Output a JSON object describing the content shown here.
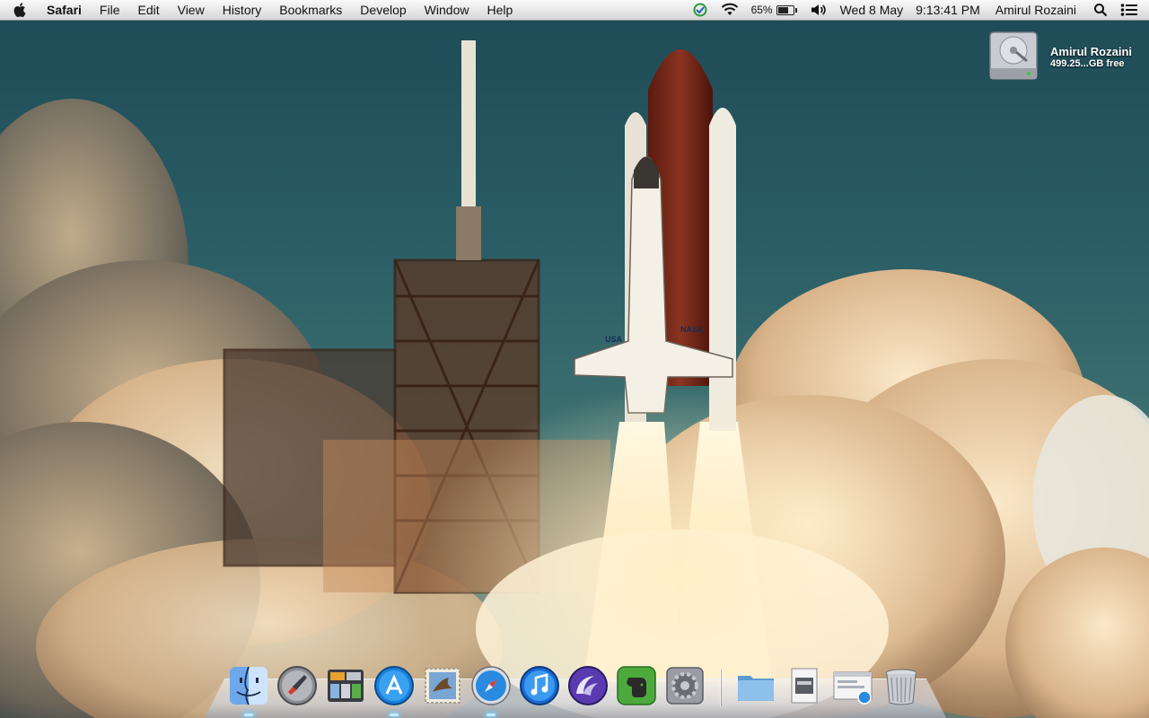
{
  "menubar": {
    "apple_icon": "apple-logo-icon",
    "app_name": "Safari",
    "menus": [
      "File",
      "Edit",
      "View",
      "History",
      "Bookmarks",
      "Develop",
      "Window",
      "Help"
    ],
    "status": {
      "sync_icon": "time-machine-sync-icon",
      "wifi_icon": "wifi-icon",
      "battery_percent": "65%",
      "battery_level": 0.65,
      "volume_icon": "speaker-volume-icon",
      "date": "Wed 8 May",
      "time": "9:13:41 PM",
      "user": "Amirul Rozaini",
      "spotlight_icon": "search-icon",
      "notifications_icon": "notification-list-icon"
    }
  },
  "desktop": {
    "wallpaper": "space-shuttle-launch",
    "drive": {
      "icon": "hard-drive-icon",
      "name": "Amirul Rozaini",
      "free": "499.25...GB free"
    }
  },
  "dock": {
    "apps": [
      {
        "name": "Finder",
        "icon": "finder-icon",
        "running": true
      },
      {
        "name": "Launchpad",
        "icon": "launchpad-rocket-icon",
        "running": false
      },
      {
        "name": "Mission Control",
        "icon": "mission-control-icon",
        "running": false
      },
      {
        "name": "App Store",
        "icon": "app-store-icon",
        "running": true
      },
      {
        "name": "Mail",
        "icon": "mail-stamp-icon",
        "running": false
      },
      {
        "name": "Safari",
        "icon": "safari-compass-icon",
        "running": true
      },
      {
        "name": "iTunes",
        "icon": "itunes-note-icon",
        "running": false
      },
      {
        "name": "BitTorrent",
        "icon": "bittorrent-icon",
        "running": false
      },
      {
        "name": "Evernote",
        "icon": "evernote-elephant-icon",
        "running": false
      },
      {
        "name": "System Preferences",
        "icon": "system-preferences-gear-icon",
        "running": false
      }
    ],
    "stacks": [
      {
        "name": "Folder",
        "icon": "folder-stack-icon"
      },
      {
        "name": "Downloads",
        "icon": "downloads-stack-icon"
      },
      {
        "name": "Web Document",
        "icon": "web-document-stack-icon"
      },
      {
        "name": "Trash",
        "icon": "trash-icon"
      }
    ]
  },
  "colors": {
    "menubar_top": "#fafafa",
    "menubar_bottom": "#d6d6d6",
    "sky": "#1d4a56",
    "smoke": "#f2dcb8",
    "evernote_green": "#4caa3c",
    "app_store_blue": "#1a7fd8"
  }
}
